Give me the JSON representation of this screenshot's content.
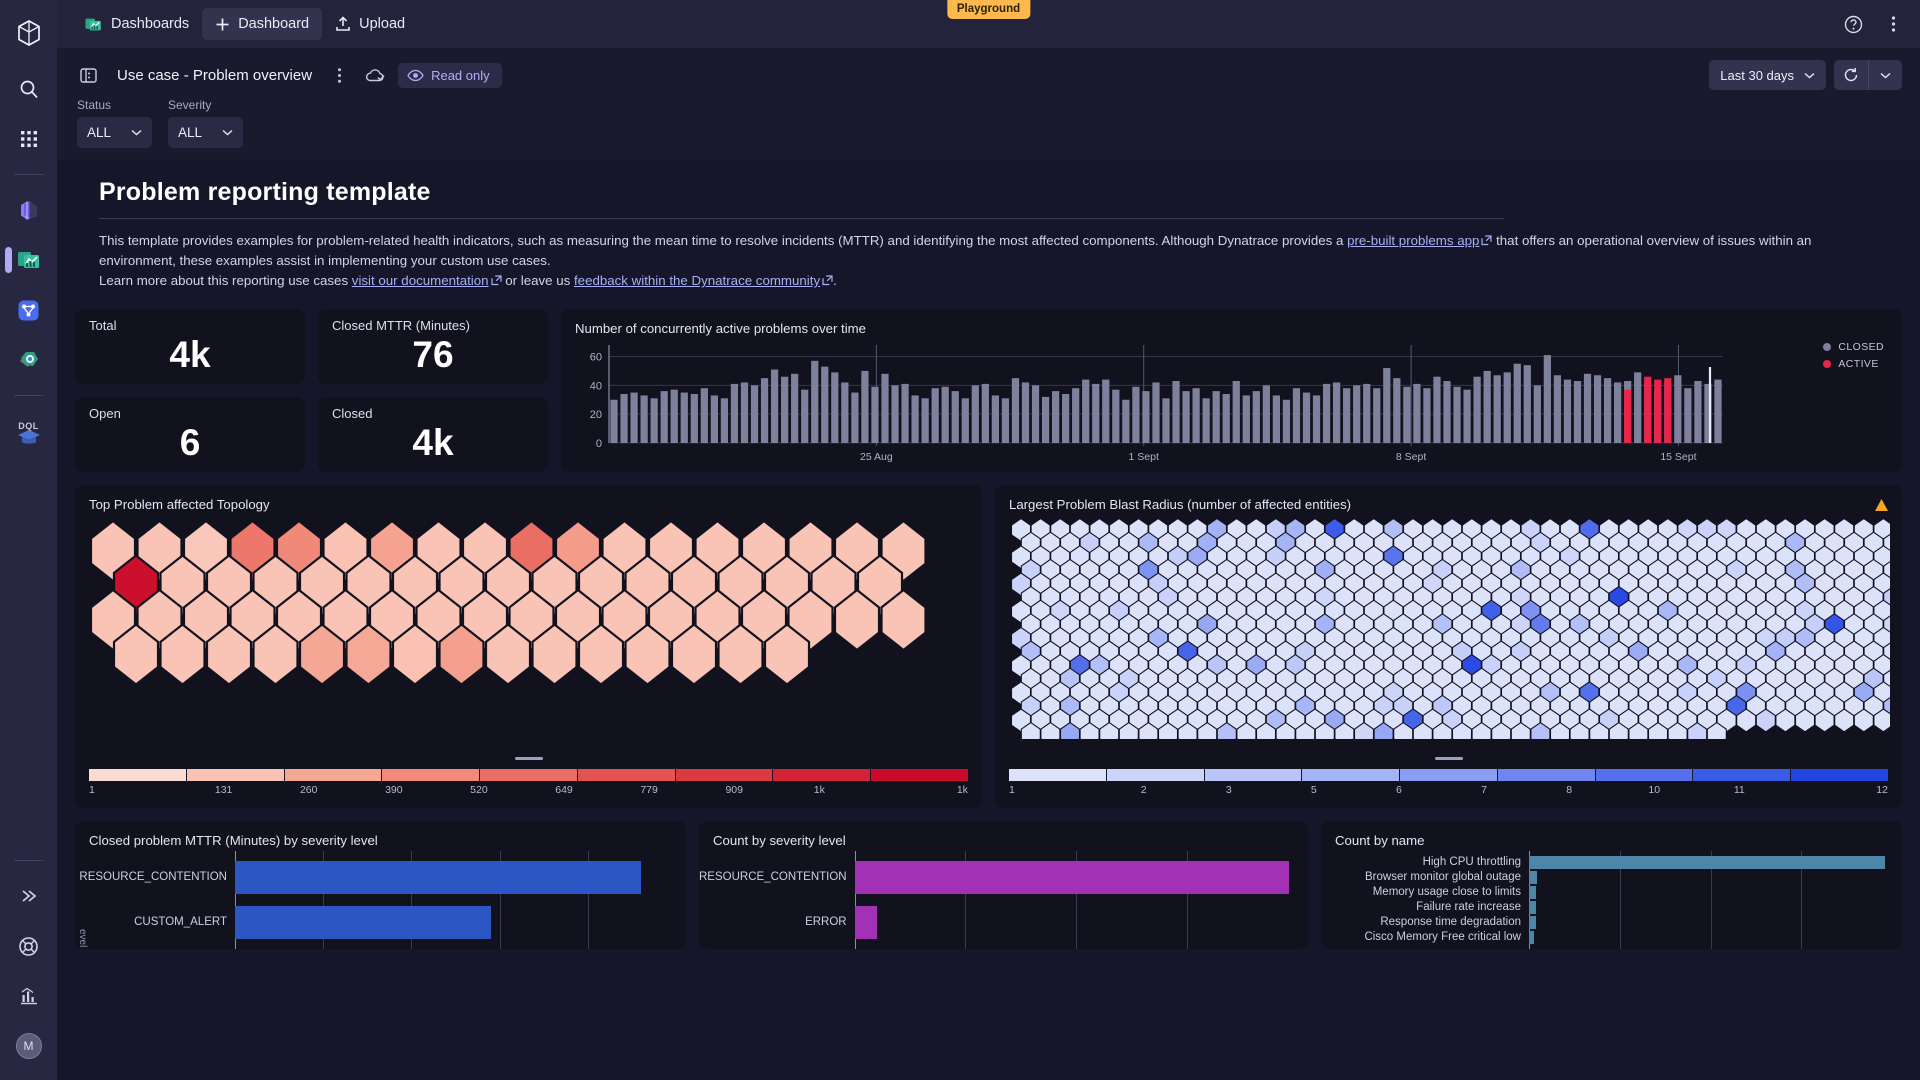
{
  "appbar": {
    "tabs": [
      {
        "label": "Dashboards",
        "icon": "dashboards-app-icon",
        "selected": false
      },
      {
        "label": "Dashboard",
        "icon": "plus-icon",
        "selected": true
      },
      {
        "label": "Upload",
        "icon": "upload-icon",
        "selected": false
      }
    ],
    "playground_badge": "Playground",
    "help_icon": "help-circle-icon",
    "more_icon": "more-vertical-icon"
  },
  "rail": {
    "logo": "dynatrace-logo",
    "items": [
      {
        "name": "search-icon"
      },
      {
        "name": "apps-grid-icon"
      },
      {
        "name": "notebooks-icon"
      },
      {
        "name": "dashboards-icon"
      },
      {
        "name": "workflows-icon"
      },
      {
        "name": "automation-icon"
      },
      {
        "name": "dql-graduation-cap-icon"
      }
    ],
    "bottom_items": [
      {
        "name": "expand-chevrons-icon"
      },
      {
        "name": "lifebuoy-help-icon"
      },
      {
        "name": "metrics-chart-icon"
      },
      {
        "name": "user-avatar",
        "label": "M"
      }
    ]
  },
  "toolbar": {
    "doc_icon": "dashboard-document-icon",
    "title": "Use case - Problem overview",
    "more_icon": "more-vertical-icon",
    "cloud_icon": "cloud-saved-icon",
    "readonly_label": "Read only",
    "readonly_icon": "eye-icon",
    "timerange_label": "Last 30 days",
    "timerange_chevron": "chevron-down-icon",
    "refresh_icon": "refresh-icon",
    "refresh_chevron": "chevron-down-icon"
  },
  "filters": [
    {
      "label": "Status",
      "value": "ALL",
      "chevron": "chevron-down-icon"
    },
    {
      "label": "Severity",
      "value": "ALL",
      "chevron": "chevron-down-icon"
    }
  ],
  "markdown": {
    "heading": "Problem reporting template",
    "p1_a": "This template provides examples for problem-related health indicators, such as measuring the mean time to resolve incidents (MTTR) and identifying the most affected components. Although Dynatrace provides a ",
    "p1_link": "pre-built problems app",
    "p1_b": " that offers an operational overview of issues within an environment, these examples assist in implementing your custom use cases.",
    "p2_a": "Learn more about this reporting use cases ",
    "p2_link1": "visit our documentation",
    "p2_b": " or leave us ",
    "p2_link2": "feedback within the Dynatrace community",
    "p2_c": "."
  },
  "kpis": [
    {
      "label": "Total",
      "value": "4k"
    },
    {
      "label": "Closed MTTR (Minutes)",
      "value": "76"
    },
    {
      "label": "Open",
      "value": "6"
    },
    {
      "label": "Closed",
      "value": "4k"
    }
  ],
  "timeseries": {
    "title": "Number of concurrently active problems over time",
    "legend": [
      {
        "label": "CLOSED",
        "color": "#7e819c"
      },
      {
        "label": "ACTIVE",
        "color": "#e8254a"
      }
    ]
  },
  "topology": {
    "title": "Top Problem affected Topology",
    "scale_ticks": [
      "1",
      "131",
      "260",
      "390",
      "520",
      "649",
      "779",
      "909",
      "1k",
      "1k"
    ],
    "scale_colors": [
      "#fbdcd2",
      "#f9c3b4",
      "#f6a695",
      "#f18a7a",
      "#ea6e63",
      "#e35450",
      "#dc3a41",
      "#d42236",
      "#cc0b2c"
    ]
  },
  "blastradius": {
    "title": "Largest Problem Blast Radius (number of affected entities)",
    "warning_icon": "warning-triangle-icon",
    "scale_ticks": [
      "1",
      "2",
      "3",
      "5",
      "6",
      "7",
      "8",
      "10",
      "11",
      "12"
    ],
    "scale_colors": [
      "#dde2fb",
      "#ccd4fa",
      "#b9c5f8",
      "#a3b3f6",
      "#8a9df3",
      "#6f86f0",
      "#5470ec",
      "#3a5ae8",
      "#2445e3"
    ]
  },
  "mttr_chart": {
    "title": "Closed problem MTTR (Minutes) by severity level",
    "axis_caption": "evel"
  },
  "count_severity": {
    "title": "Count by severity level"
  },
  "count_name": {
    "title": "Count by name"
  },
  "chart_data": [
    {
      "type": "bar",
      "title": "Number of concurrently active problems over time",
      "xlabel": "",
      "ylabel": "",
      "ylim": [
        0,
        68
      ],
      "yticks": [
        0,
        20,
        40,
        60
      ],
      "xticks": [
        "25 Aug",
        "1 Sept",
        "8 Sept",
        "15 Sept"
      ],
      "series": [
        {
          "name": "CLOSED",
          "color": "#7e819c",
          "values": [
            30,
            34,
            35,
            33,
            31,
            36,
            37,
            35,
            34,
            38,
            33,
            31,
            41,
            42,
            40,
            45,
            51,
            46,
            48,
            37,
            57,
            53,
            49,
            42,
            35,
            50,
            39,
            48,
            40,
            41,
            33,
            31,
            38,
            39,
            36,
            31,
            40,
            41,
            33,
            31,
            45,
            42,
            40,
            32,
            36,
            34,
            38,
            44,
            41,
            44,
            37,
            30,
            39,
            36,
            42,
            31,
            43,
            36,
            38,
            31,
            36,
            34,
            43,
            33,
            36,
            40,
            33,
            30,
            38,
            35,
            33,
            41,
            42,
            38,
            40,
            41,
            38,
            52,
            45,
            39,
            41,
            38,
            46,
            43,
            39,
            37,
            46,
            50,
            47,
            49,
            55,
            54,
            40,
            61,
            47,
            44,
            43,
            48,
            47,
            45,
            42,
            43,
            49,
            42,
            36,
            42,
            47,
            38,
            43,
            41,
            44
          ]
        },
        {
          "name": "ACTIVE",
          "color": "#e8254a",
          "values": [
            null,
            null,
            null,
            null,
            null,
            null,
            null,
            null,
            null,
            null,
            null,
            null,
            null,
            null,
            null,
            null,
            null,
            null,
            null,
            null,
            null,
            null,
            null,
            null,
            null,
            null,
            null,
            null,
            null,
            null,
            null,
            null,
            null,
            null,
            null,
            null,
            null,
            null,
            null,
            null,
            null,
            null,
            null,
            null,
            null,
            null,
            null,
            null,
            null,
            null,
            null,
            null,
            null,
            null,
            null,
            null,
            null,
            null,
            null,
            null,
            null,
            null,
            null,
            null,
            null,
            null,
            null,
            null,
            null,
            null,
            null,
            null,
            null,
            null,
            null,
            null,
            null,
            null,
            null,
            null,
            null,
            null,
            null,
            null,
            null,
            null,
            null,
            null,
            null,
            null,
            null,
            null,
            null,
            null,
            null,
            null,
            null,
            null,
            null,
            null,
            null,
            37,
            null,
            46,
            44,
            45,
            null,
            null,
            null,
            null
          ]
        }
      ]
    },
    {
      "type": "heatmap",
      "title": "Top Problem affected Topology",
      "colorscale_min": 1,
      "colorscale_max": 1000,
      "colorscale_ticks": [
        "1",
        "131",
        "260",
        "390",
        "520",
        "649",
        "779",
        "909",
        "1k",
        "1k"
      ],
      "palette": "reds",
      "rows": [
        [
          0.12,
          0.12,
          0.1,
          0.46,
          0.38,
          0.13,
          0.27,
          0.12,
          0.12,
          0.5,
          0.3,
          0.12,
          0.12,
          0.12,
          0.12,
          0.12,
          0.12,
          0.12
        ],
        [
          0.98,
          0.12,
          0.12,
          0.12,
          0.12,
          0.12,
          0.12,
          0.12,
          0.12,
          0.12,
          0.12,
          0.12,
          0.12,
          0.12,
          0.12,
          0.12,
          0.12
        ],
        [
          0.12,
          0.12,
          0.12,
          0.12,
          0.12,
          0.12,
          0.12,
          0.12,
          0.12,
          0.12,
          0.12,
          0.12,
          0.12,
          0.12,
          0.12,
          0.12,
          0.12,
          0.12
        ],
        [
          0.12,
          0.12,
          0.12,
          0.12,
          0.25,
          0.24,
          0.13,
          0.28,
          0.12,
          0.12,
          0.12,
          0.12,
          0.12,
          0.12,
          0.12
        ]
      ]
    },
    {
      "type": "heatmap",
      "title": "Largest Problem Blast Radius (number of affected entities)",
      "colorscale_min": 1,
      "colorscale_max": 12,
      "colorscale_ticks": [
        "1",
        "2",
        "3",
        "5",
        "6",
        "7",
        "8",
        "10",
        "11",
        "12"
      ],
      "palette": "blues",
      "grid_cols": 45,
      "grid_rows": 16,
      "note": "mostly value 1 (palest); sparse scattered cells at values 3-12"
    },
    {
      "type": "bar",
      "orientation": "horizontal",
      "title": "Closed problem MTTR (Minutes) by severity level",
      "categories": [
        "RESOURCE_CONTENTION",
        "CUSTOM_ALERT"
      ],
      "values": [
        92,
        58
      ],
      "xlim": [
        0,
        100
      ],
      "color": "#2e55c4"
    },
    {
      "type": "bar",
      "orientation": "horizontal",
      "title": "Count by severity level",
      "categories": [
        "RESOURCE_CONTENTION",
        "ERROR"
      ],
      "values": [
        98,
        5
      ],
      "xlim": [
        0,
        100
      ],
      "color": "#a331b5"
    },
    {
      "type": "bar",
      "orientation": "horizontal",
      "title": "Count by name",
      "categories": [
        "High CPU throttling",
        "Browser monitor global outage",
        "Memory usage close to limits",
        "Failure rate increase",
        "Response time degradation",
        "Cisco Memory Free critical low"
      ],
      "values": [
        98,
        2.2,
        2.0,
        1.9,
        1.8,
        1.5
      ],
      "xlim": [
        0,
        100
      ],
      "color": "#4c86a8"
    }
  ]
}
